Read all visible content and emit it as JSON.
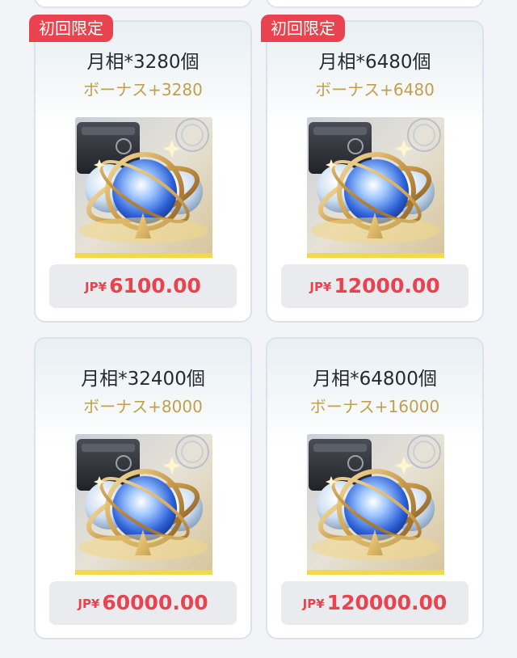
{
  "accent_color": "#e8434f",
  "bonus_color": "#c0a04e",
  "products": [
    {
      "badge": "初回限定",
      "title": "月相*3280個",
      "bonus": "ボーナス+3280",
      "currency": "JP¥",
      "price": "6100.00",
      "image": "moon-orb-bundle-icon"
    },
    {
      "badge": "初回限定",
      "title": "月相*6480個",
      "bonus": "ボーナス+6480",
      "currency": "JP¥",
      "price": "12000.00",
      "image": "moon-orb-bundle-icon"
    },
    {
      "badge": "",
      "title": "月相*32400個",
      "bonus": "ボーナス+8000",
      "currency": "JP¥",
      "price": "60000.00",
      "image": "moon-orb-bundle-icon"
    },
    {
      "badge": "",
      "title": "月相*64800個",
      "bonus": "ボーナス+16000",
      "currency": "JP¥",
      "price": "120000.00",
      "image": "moon-orb-bundle-icon"
    }
  ]
}
